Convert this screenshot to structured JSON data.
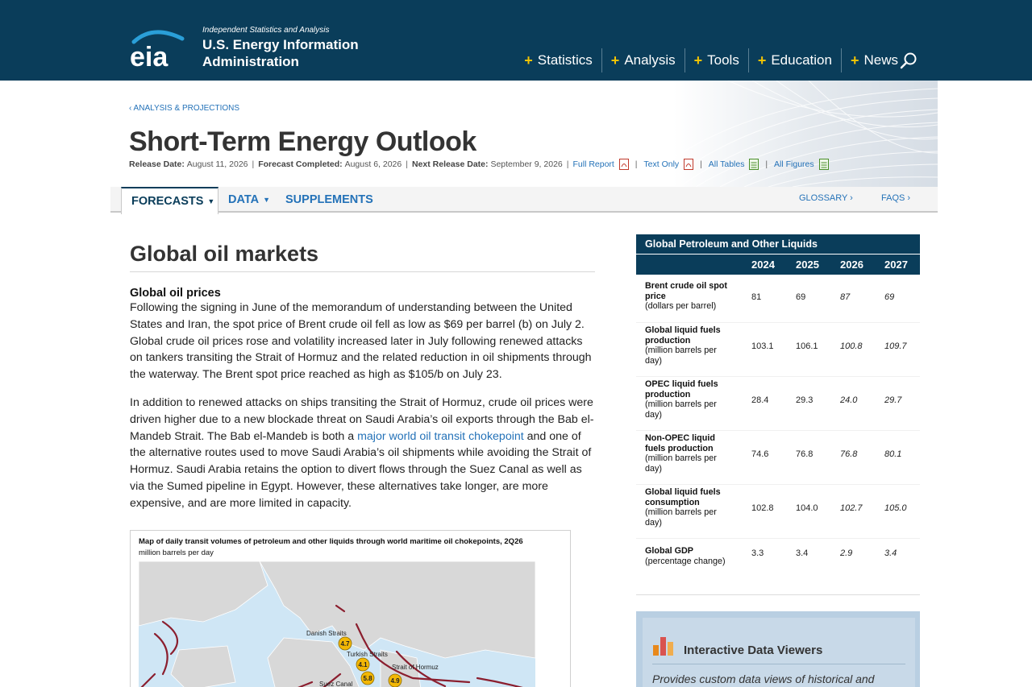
{
  "header": {
    "tagline": "Independent Statistics and Analysis",
    "org_line1": "U.S. Energy Information",
    "org_line2": "Administration",
    "logo_text": "eia",
    "nav": [
      {
        "label": "Statistics"
      },
      {
        "label": "Analysis"
      },
      {
        "label": "Tools"
      },
      {
        "label": "Education"
      },
      {
        "label": "News"
      }
    ]
  },
  "banner": {
    "breadcrumb": "‹ ANALYSIS & PROJECTIONS",
    "title": "Short-Term Energy Outlook",
    "release_label": "Release Date:",
    "release_date": "August 11, 2026",
    "forecast_label": "Forecast Completed:",
    "forecast_date": "August 6, 2026",
    "next_label": "Next Release Date:",
    "next_date": "September 9, 2026",
    "links": {
      "full_report": "Full Report",
      "text_only": "Text Only",
      "all_tables": "All Tables",
      "all_figures": "All Figures"
    }
  },
  "subnav": {
    "forecasts": "FORECASTS",
    "data": "DATA",
    "supplements": "SUPPLEMENTS",
    "glossary": "GLOSSARY ›",
    "faqs": "FAQS ›"
  },
  "article": {
    "section_title": "Global oil markets",
    "subtitle": "Global oil prices",
    "para1": "Following the signing in June of the memorandum of understanding between the United States and Iran, the spot price of Brent crude oil fell as low as $69 per barrel (b) on July 2. Global crude oil prices rose and volatility increased later in July following renewed attacks on tankers transiting the Strait of Hormuz and the related reduction in oil shipments through the waterway. The Brent spot price reached as high as $105/b on July 23.",
    "para2_a": "In addition to renewed attacks on ships transiting the Strait of Hormuz, crude oil prices were driven higher due to a new blockade threat on Saudi Arabia’s oil exports through the Bab el-Mandeb Strait. The Bab el-Mandeb is both a ",
    "para2_link": "major world oil transit chokepoint",
    "para2_b": " and one of the alternative routes used to move Saudi Arabia’s oil shipments while avoiding the Strait of Hormuz. Saudi Arabia retains the option to divert flows through the Suez Canal as well as via the Sumed pipeline in Egypt. However, these alternatives take longer, are more expensive, and are more limited in capacity."
  },
  "map": {
    "title": "Map of daily transit volumes of petroleum and other liquids through world maritime oil chokepoints, 2Q26",
    "units": "million barrels per day",
    "labels": [
      {
        "name": "Danish Straits",
        "value": "4.7"
      },
      {
        "name": "Turkish Straits",
        "value": "4.1"
      },
      {
        "name": "Strait of Hormuz",
        "value": "4.9"
      },
      {
        "name": "Suez Canal",
        "value": "5.8"
      }
    ]
  },
  "sidebar_table": {
    "title": "Global Petroleum and Other Liquids",
    "years": [
      "2024",
      "2025",
      "2026",
      "2027"
    ],
    "rows": [
      {
        "label": "Brent crude oil spot price",
        "unit": "(dollars per barrel)",
        "values": [
          "81",
          "69",
          "87",
          "69"
        ]
      },
      {
        "label": "Global liquid fuels production",
        "unit": "(million barrels per day)",
        "values": [
          "103.1",
          "106.1",
          "100.8",
          "109.7"
        ]
      },
      {
        "label": "OPEC liquid fuels production",
        "unit": "(million barrels per day)",
        "values": [
          "28.4",
          "29.3",
          "24.0",
          "29.7"
        ]
      },
      {
        "label": "Non-OPEC liquid fuels production",
        "unit": "(million barrels per day)",
        "values": [
          "74.6",
          "76.8",
          "76.8",
          "80.1"
        ]
      },
      {
        "label": "Global liquid fuels consumption",
        "unit": "(million barrels per day)",
        "values": [
          "102.8",
          "104.0",
          "102.7",
          "105.0"
        ]
      },
      {
        "label": "Global GDP",
        "unit": "(percentage change)",
        "values": [
          "3.3",
          "3.4",
          "2.9",
          "3.4"
        ]
      }
    ]
  },
  "data_viewers": {
    "title": "Interactive Data Viewers",
    "text": "Provides custom data views of historical and"
  },
  "colors": {
    "header_bg": "#0a3d5a",
    "accent_plus": "#f5c400",
    "link": "#2472b8"
  }
}
